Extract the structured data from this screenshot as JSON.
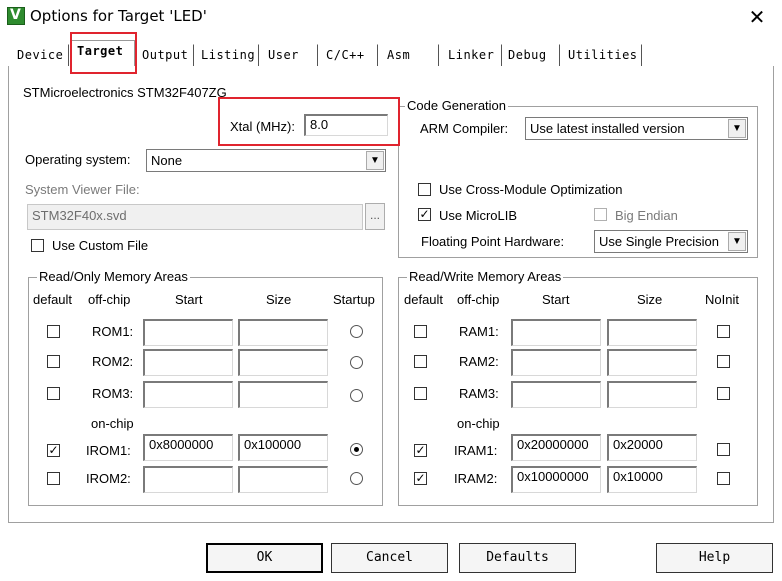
{
  "window": {
    "title": "Options for Target 'LED'",
    "icon": "keil-icon",
    "close": "✕"
  },
  "tabs": [
    {
      "label": "Device"
    },
    {
      "label": "Target"
    },
    {
      "label": "Output"
    },
    {
      "label": "Listing"
    },
    {
      "label": "User"
    },
    {
      "label": "C/C++"
    },
    {
      "label": "Asm"
    },
    {
      "label": "Linker"
    },
    {
      "label": "Debug"
    },
    {
      "label": "Utilities"
    }
  ],
  "device_name": "STMicroelectronics STM32F407ZG",
  "xtal": {
    "label": "Xtal (MHz):",
    "value": "8.0"
  },
  "os": {
    "label": "Operating system:",
    "value": "None"
  },
  "svd": {
    "label": "System Viewer File:",
    "value": "STM32F40x.svd",
    "browse": "..."
  },
  "custom_file": {
    "label": "Use Custom File",
    "checked": false
  },
  "codegen": {
    "title": "Code Generation",
    "compiler_label": "ARM Compiler:",
    "compiler_value": "Use latest installed version",
    "cross_module": {
      "label": "Use Cross-Module Optimization",
      "checked": false
    },
    "microlib": {
      "label": "Use MicroLIB",
      "checked": true,
      "mark": "✓"
    },
    "big_endian": {
      "label": "Big Endian",
      "checked": false
    },
    "fpu_label": "Floating Point Hardware:",
    "fpu_value": "Use Single Precision"
  },
  "rom": {
    "title": "Read/Only Memory Areas",
    "headers": {
      "default": "default",
      "offchip": "off-chip",
      "start": "Start",
      "size": "Size",
      "startup": "Startup"
    },
    "onchip_label": "on-chip",
    "rows": [
      {
        "name": "ROM1:",
        "default": false,
        "start": "",
        "size": "",
        "startup": false
      },
      {
        "name": "ROM2:",
        "default": false,
        "start": "",
        "size": "",
        "startup": false
      },
      {
        "name": "ROM3:",
        "default": false,
        "start": "",
        "size": "",
        "startup": false
      },
      {
        "name": "IROM1:",
        "default": true,
        "start": "0x8000000",
        "size": "0x100000",
        "startup": true
      },
      {
        "name": "IROM2:",
        "default": false,
        "start": "",
        "size": "",
        "startup": false
      }
    ]
  },
  "ram": {
    "title": "Read/Write Memory Areas",
    "headers": {
      "default": "default",
      "offchip": "off-chip",
      "start": "Start",
      "size": "Size",
      "noinit": "NoInit"
    },
    "onchip_label": "on-chip",
    "rows": [
      {
        "name": "RAM1:",
        "default": false,
        "start": "",
        "size": "",
        "noinit": false
      },
      {
        "name": "RAM2:",
        "default": false,
        "start": "",
        "size": "",
        "noinit": false
      },
      {
        "name": "RAM3:",
        "default": false,
        "start": "",
        "size": "",
        "noinit": false
      },
      {
        "name": "IRAM1:",
        "default": true,
        "start": "0x20000000",
        "size": "0x20000",
        "noinit": false
      },
      {
        "name": "IRAM2:",
        "default": true,
        "start": "0x10000000",
        "size": "0x10000",
        "noinit": false
      }
    ]
  },
  "buttons": {
    "ok": "OK",
    "cancel": "Cancel",
    "defaults": "Defaults",
    "help": "Help"
  },
  "check_mark": "✓",
  "dropdown_arrow": "▼",
  "highlight_color": "#e0242e"
}
